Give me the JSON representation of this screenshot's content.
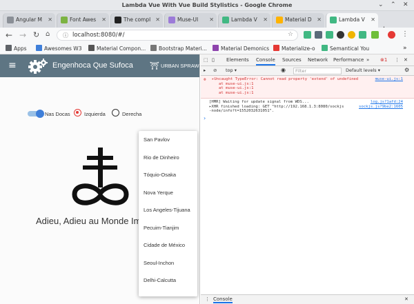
{
  "window": {
    "title": "Lambda Vue With Vue Build Stylistics - Google Chrome"
  },
  "tabs": [
    {
      "label": "Angular M",
      "color": "#8a8f96"
    },
    {
      "label": "Font Awes",
      "color": "#7cb342"
    },
    {
      "label": "The compl",
      "color": "#222222"
    },
    {
      "label": "Muse-UI",
      "color": "#9c7bd8"
    },
    {
      "label": "Lambda V",
      "color": "#41b883"
    },
    {
      "label": "Material D",
      "color": "#ffb300"
    },
    {
      "label": "Lambda V",
      "color": "#41b883"
    }
  ],
  "omnibar": {
    "url": "localhost:8080/#/"
  },
  "bookmarks": [
    {
      "label": "Apps",
      "color": "#5f6368"
    },
    {
      "label": "Awesomes W3",
      "color": "#3f7fd9"
    },
    {
      "label": "Material Compon...",
      "color": "#555555"
    },
    {
      "label": "Bootstrap Materi...",
      "color": "#666666"
    },
    {
      "label": "Material Demonics",
      "color": "#8e44ad"
    },
    {
      "label": "Materialize-o",
      "color": "#e53935"
    },
    {
      "label": "Semantical You",
      "color": "#41b883"
    }
  ],
  "app": {
    "title": "Engenhoca Que Sufoca",
    "urban_label": "URBAN SPRAWL",
    "toggle_label": "Nas Docas",
    "radio_left": "Izquierda",
    "radio_right": "Derecha",
    "headline": "Adieu, Adieu au Monde Im"
  },
  "menu": {
    "items": [
      "San Pavlov",
      "Rio de Dinheiro",
      "Tóquio-Osaka",
      "Nova Yerque",
      "Los Angeles-Tijuana",
      "Pecuim-Tianjim",
      "Cidade de México",
      "Seoul-Inchon",
      "Delhi-Calcutta"
    ]
  },
  "devtools": {
    "tabs": [
      "Elements",
      "Console",
      "Sources",
      "Network",
      "Performance"
    ],
    "context": "top",
    "filter_placeholder": "Filter",
    "levels": "Default levels",
    "error_count": "1",
    "error_lines": [
      "▸Uncaught TypeError: Cannot read property 'extend' of undefined",
      "at muse-ui.js:1",
      "at muse-ui.js:1",
      "at muse-ui.js:1"
    ],
    "error_source": "muse-ui.js:1",
    "msg1": "[HMR] Waiting for update signal from WDS...",
    "msg1_source": "log.js?1afd:24",
    "msg2a": "▸XHR finished loading: GET \"http://192.168.1.3:8080/sockjs",
    "msg2b": "-node/info?t=1552032631051\".",
    "msg2_source": "sockjs.js?9be2:1605",
    "drawer_tab": "Console"
  }
}
